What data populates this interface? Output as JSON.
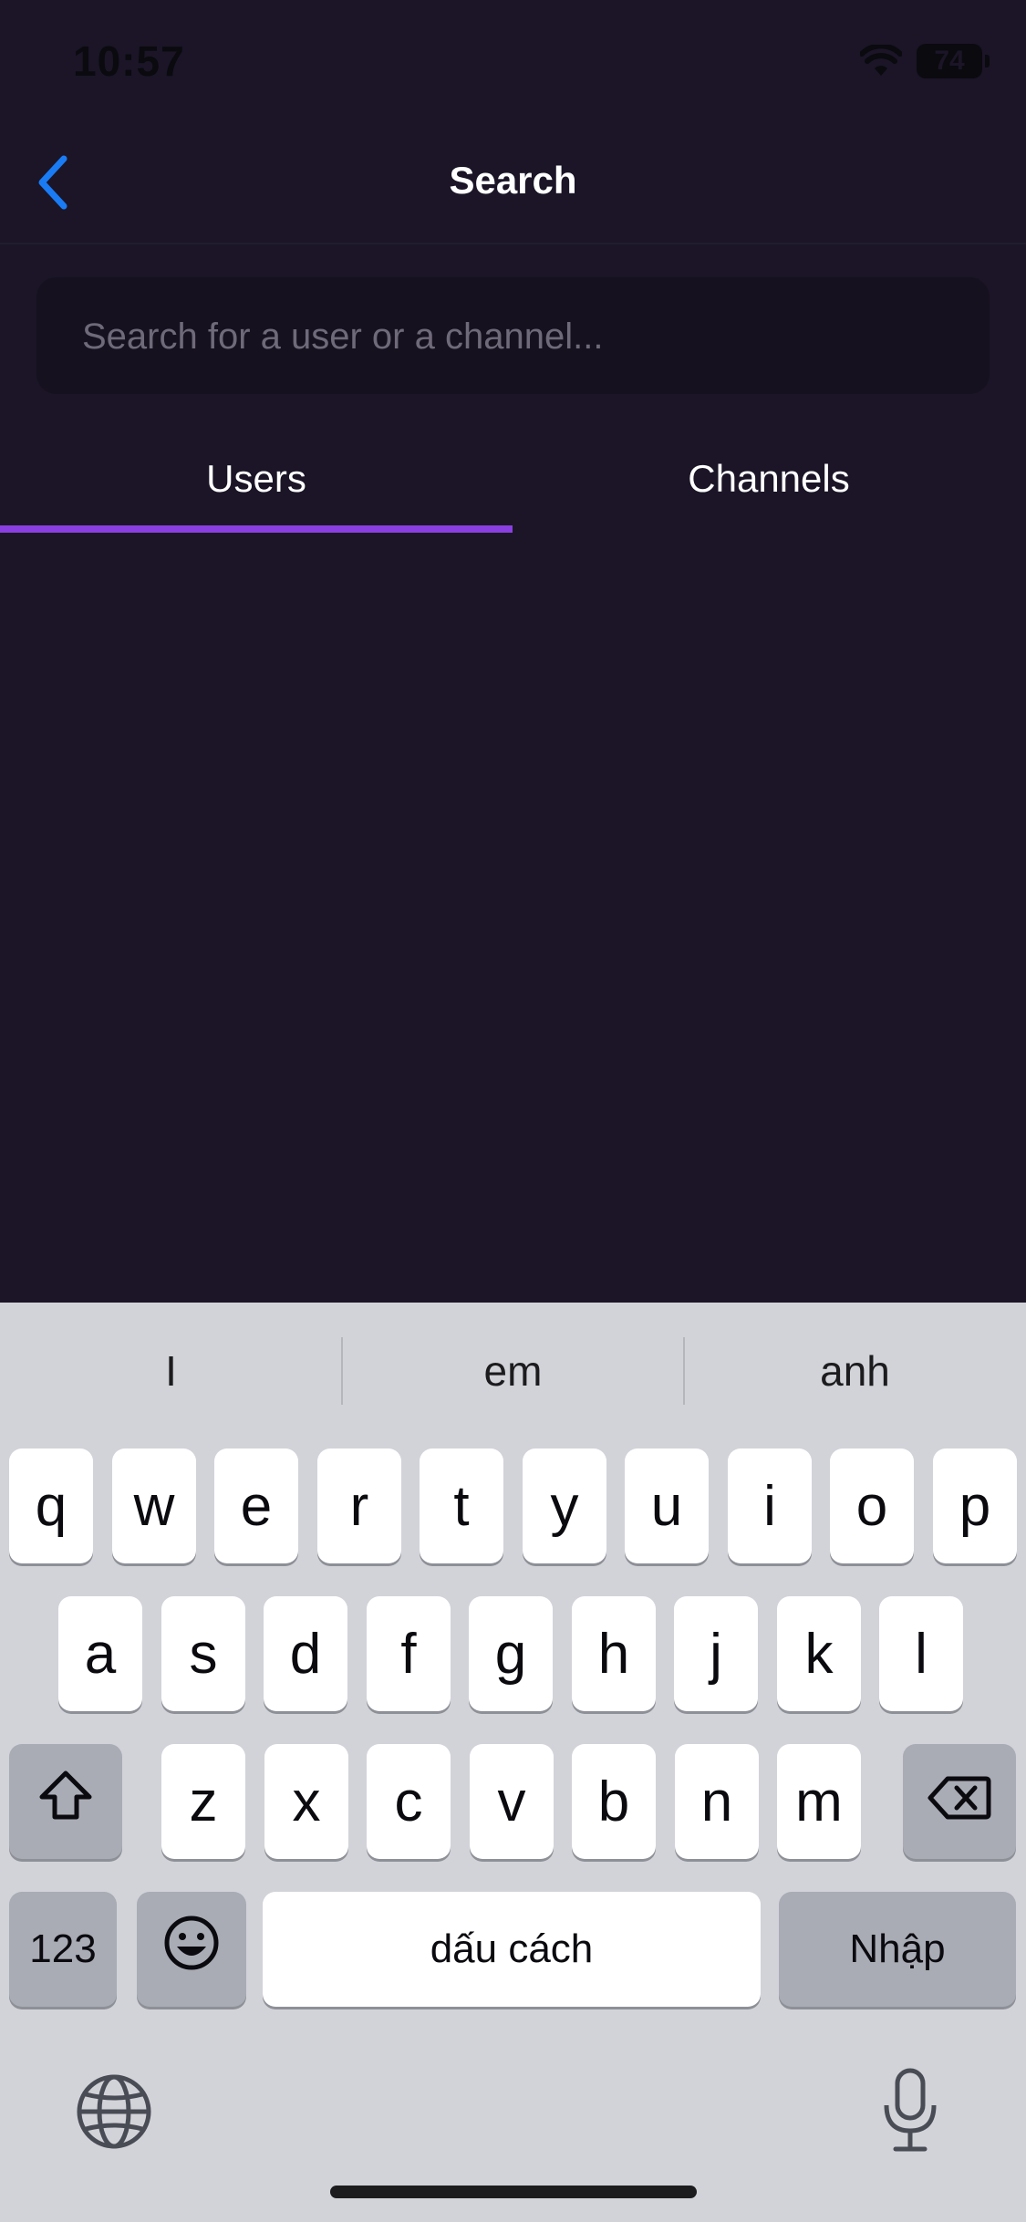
{
  "status_bar": {
    "time": "10:57",
    "battery": "74"
  },
  "nav": {
    "title": "Search"
  },
  "search": {
    "placeholder": "Search for a user or a channel...",
    "value": ""
  },
  "tabs": [
    {
      "label": "Users",
      "active": true
    },
    {
      "label": "Channels",
      "active": false
    }
  ],
  "colors": {
    "background": "#1b1527",
    "accent": "#8a3fe0",
    "back_icon": "#1a7cf5",
    "keyboard": "#d2d3d9"
  },
  "keyboard": {
    "suggestions": [
      "I",
      "em",
      "anh"
    ],
    "row1": [
      "q",
      "w",
      "e",
      "r",
      "t",
      "y",
      "u",
      "i",
      "o",
      "p"
    ],
    "row2": [
      "a",
      "s",
      "d",
      "f",
      "g",
      "h",
      "j",
      "k",
      "l"
    ],
    "row3": [
      "z",
      "x",
      "c",
      "v",
      "b",
      "n",
      "m"
    ],
    "numbers_label": "123",
    "space_label": "dấu cách",
    "return_label": "Nhập"
  },
  "icons": [
    "chevron-left-icon",
    "wifi-icon",
    "battery-icon",
    "shift-icon",
    "backspace-icon",
    "emoji-icon",
    "globe-icon",
    "microphone-icon"
  ]
}
